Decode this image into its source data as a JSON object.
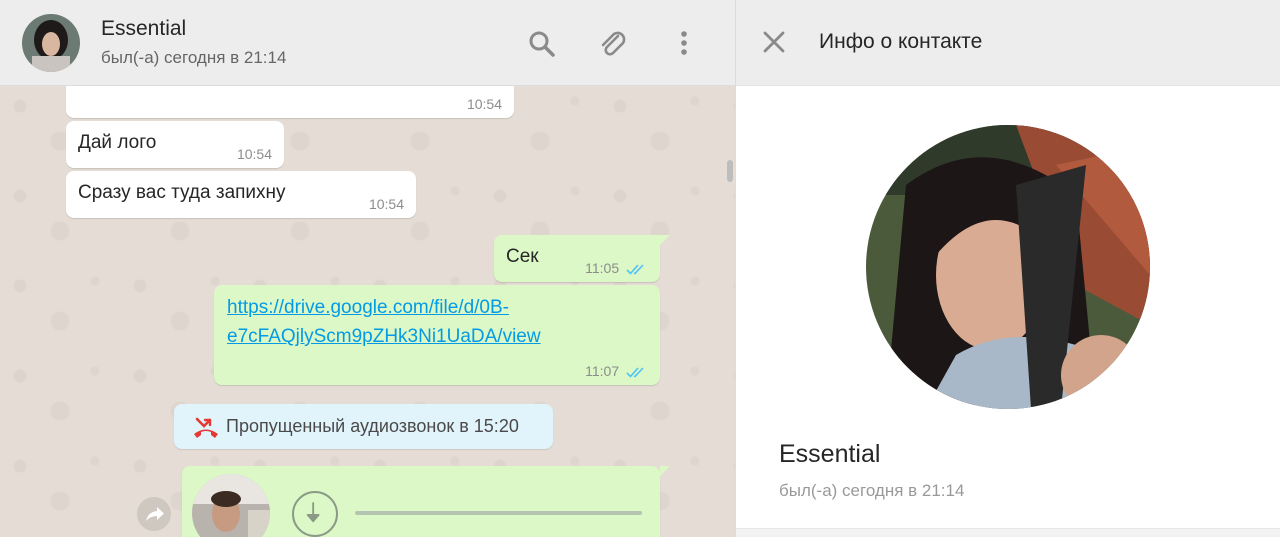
{
  "chat": {
    "contact_name": "Essential",
    "contact_status": "был(-а) сегодня в 21:14",
    "header_icons": [
      "search-icon",
      "paperclip-icon",
      "menu-dots-icon"
    ],
    "messages": [
      {
        "direction": "in",
        "text": "",
        "time": "10:54"
      },
      {
        "direction": "in",
        "text": "Дай лого",
        "time": "10:54"
      },
      {
        "direction": "in",
        "text": "Сразу вас туда запихну",
        "time": "10:54"
      },
      {
        "direction": "out",
        "text": "Сек",
        "time": "11:05",
        "read": true
      },
      {
        "direction": "out",
        "link_line1": "https://drive.google.com/file/d/0B-",
        "link_line2": "e7cFAQjlyScm9pZHk3Ni1UaDA/view",
        "time": "11:07",
        "read": true
      }
    ],
    "system_notice": "Пропущенный аудиозвонок в 15:20",
    "voice_message": {
      "icon": "download-icon"
    }
  },
  "info": {
    "title": "Инфо о контакте",
    "name": "Essential",
    "status": "был(-а) сегодня в 21:14"
  },
  "colors": {
    "outgoing_bubble": "#dcf8c6",
    "incoming_bubble": "#ffffff",
    "link": "#039be5",
    "read_ticks": "#4fc3f7",
    "missed_call": "#e53935"
  }
}
